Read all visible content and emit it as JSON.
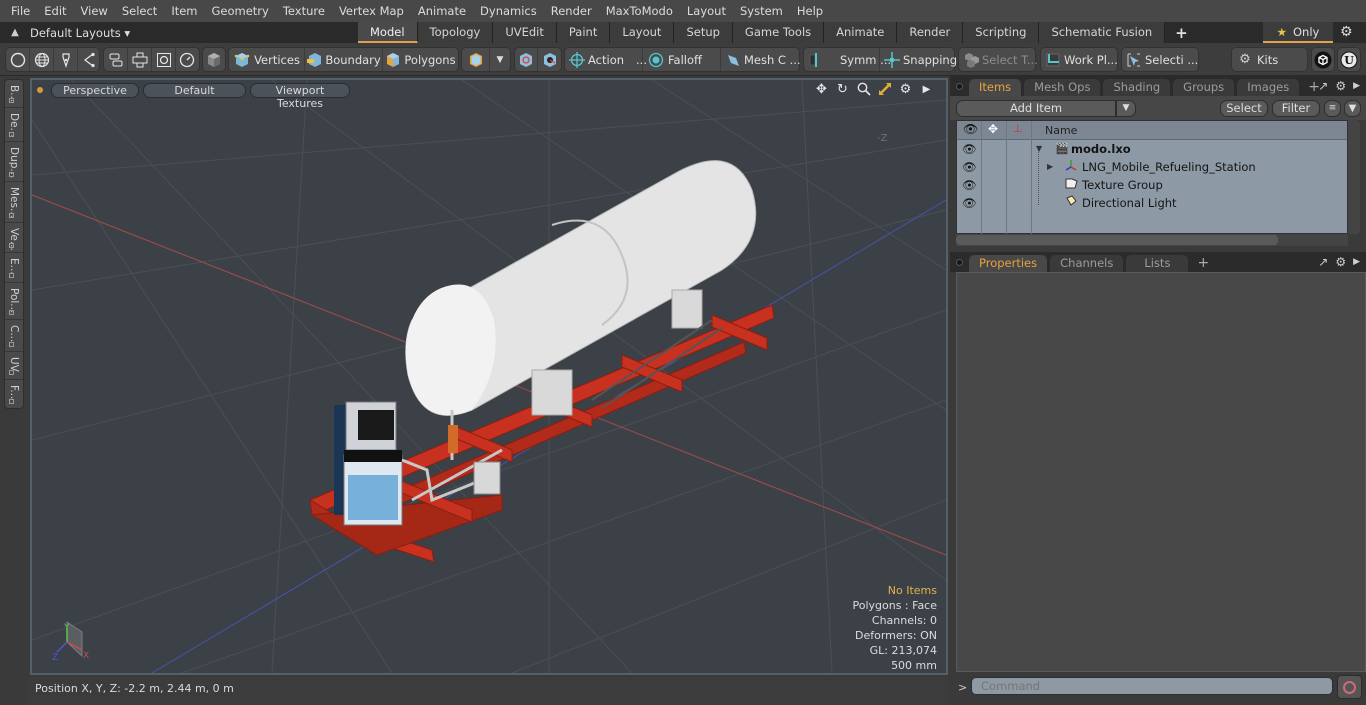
{
  "menubar": {
    "items": [
      "File",
      "Edit",
      "View",
      "Select",
      "Item",
      "Geometry",
      "Texture",
      "Vertex Map",
      "Animate",
      "Dynamics",
      "Render",
      "MaxToModo",
      "Layout",
      "System",
      "Help"
    ]
  },
  "layoutbar": {
    "dropdown_label": "Default Layouts ▾",
    "tabs": [
      "Model",
      "Topology",
      "UVEdit",
      "Paint",
      "Layout",
      "Setup",
      "Game Tools",
      "Animate",
      "Render",
      "Scripting",
      "Schematic Fusion"
    ],
    "active_tab": "Model",
    "add_label": "+",
    "only_label": "Only"
  },
  "toolbar": {
    "selection_modes": [
      "Vertices",
      "Boundary",
      "Polygons"
    ],
    "action_label": "Action",
    "action_more": "...",
    "falloff_label": "Falloff",
    "mesh_label": "Mesh C ...",
    "symm_label": "Symm ...",
    "snapping_label": "Snapping",
    "select_t_label": "Select T...",
    "workplane_label": "Work Pl...",
    "selecti_label": "Selecti ...",
    "kits_label": "Kits"
  },
  "lefttabs": [
    "B...",
    "De...",
    "Dup...",
    "Mes...",
    "Ve...",
    "E...",
    "Pol...",
    "C...",
    "UV",
    "F..."
  ],
  "viewport": {
    "view_label": "Perspective",
    "shading_label": "Default",
    "texture_label": "Viewport Textures",
    "axis_hint": "-Z",
    "info": {
      "selection": "No Items",
      "polygons": "Polygons : Face",
      "channels": "Channels: 0",
      "deformers": "Deformers: ON",
      "gl": "GL: 213,074",
      "grid": "500 mm"
    },
    "gizmo": {
      "x": "X",
      "y": "Y",
      "z": "Z"
    }
  },
  "statusbar": {
    "position": "Position X, Y, Z:   -2.2 m, 2.44 m, 0 m"
  },
  "items_panel": {
    "tabs": [
      "Items",
      "Mesh Ops",
      "Shading",
      "Groups",
      "Images"
    ],
    "active_tab": "Items",
    "add_item_label": "Add Item",
    "select_label": "Select",
    "filter_label": "Filter",
    "name_header": "Name",
    "rows": [
      {
        "label": "modo.lxo",
        "bold": true,
        "icon": "scene-clapper-icon"
      },
      {
        "label": "LNG_Mobile_Refueling_Station",
        "bold": false,
        "icon": "mesh-locator-icon"
      },
      {
        "label": "Texture Group",
        "bold": false,
        "icon": "texture-group-icon"
      },
      {
        "label": "Directional Light",
        "bold": false,
        "icon": "directional-light-icon"
      }
    ]
  },
  "properties_panel": {
    "tabs": [
      "Properties",
      "Channels",
      "Lists"
    ],
    "active_tab": "Properties"
  },
  "command": {
    "prompt": ">",
    "placeholder": "Command"
  },
  "colors": {
    "accent": "#e2a24c",
    "viewport_bg": "#3c4147",
    "frame_red": "#c8311f",
    "tank_white": "#e4e4e4"
  }
}
